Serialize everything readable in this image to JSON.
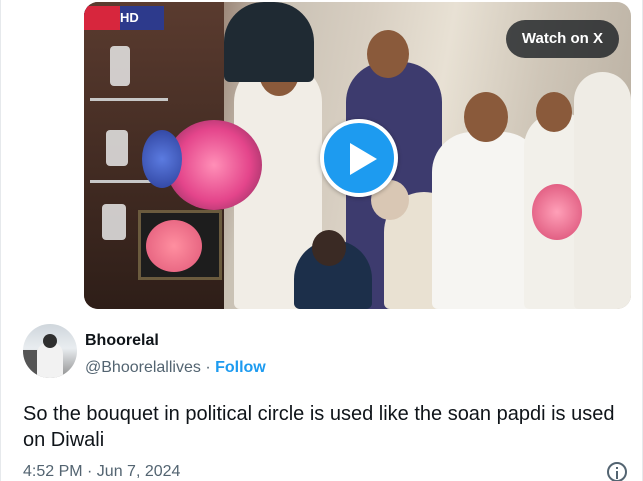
{
  "media": {
    "banner_text": "HD",
    "watch_label": "Watch on X",
    "play_icon": "play-icon"
  },
  "author": {
    "display_name": "Bhoorelal",
    "handle": "@Bhoorelallives",
    "separator": "·",
    "follow_label": "Follow"
  },
  "tweet": {
    "text": "So the bouquet in political circle is used like the soan papdi is used on Diwali"
  },
  "meta": {
    "time": "4:52 PM · Jun 7, 2024",
    "info_icon": "info-icon"
  },
  "colors": {
    "accent": "#1d9bf0",
    "text_primary": "#0f1419",
    "text_secondary": "#536471"
  }
}
